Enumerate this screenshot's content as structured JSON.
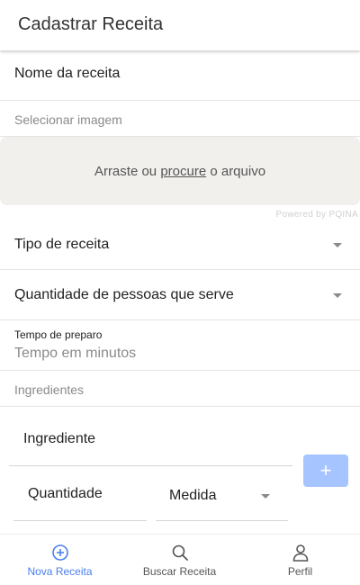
{
  "header": {
    "title": "Cadastrar Receita"
  },
  "form": {
    "name_field": "Nome da receita",
    "image_label": "Selecionar imagem",
    "dropzone": {
      "prefix": "Arraste ou ",
      "link": "procure",
      "suffix": " o arquivo"
    },
    "powered_by": "Powered by PQINA",
    "type_select": "Tipo de receita",
    "servings_select": "Quantidade de pessoas que serve",
    "prep_time": {
      "label": "Tempo de preparo",
      "placeholder": "Tempo em minutos"
    },
    "ingredients_label": "Ingredientes",
    "ingredient": {
      "name": "Ingrediente",
      "quantity": "Quantidade",
      "measure": "Medida",
      "add_label": "+"
    }
  },
  "bottom_nav": {
    "items": [
      {
        "label": "Nova Receita",
        "icon": "plus-circle-icon",
        "active": true
      },
      {
        "label": "Buscar Receita",
        "icon": "search-icon",
        "active": false
      },
      {
        "label": "Perfil",
        "icon": "person-icon",
        "active": false
      }
    ]
  },
  "colors": {
    "accent": "#4a7ef0",
    "add_button": "#a6c4ff",
    "dropzone": "#f1f0ed"
  }
}
